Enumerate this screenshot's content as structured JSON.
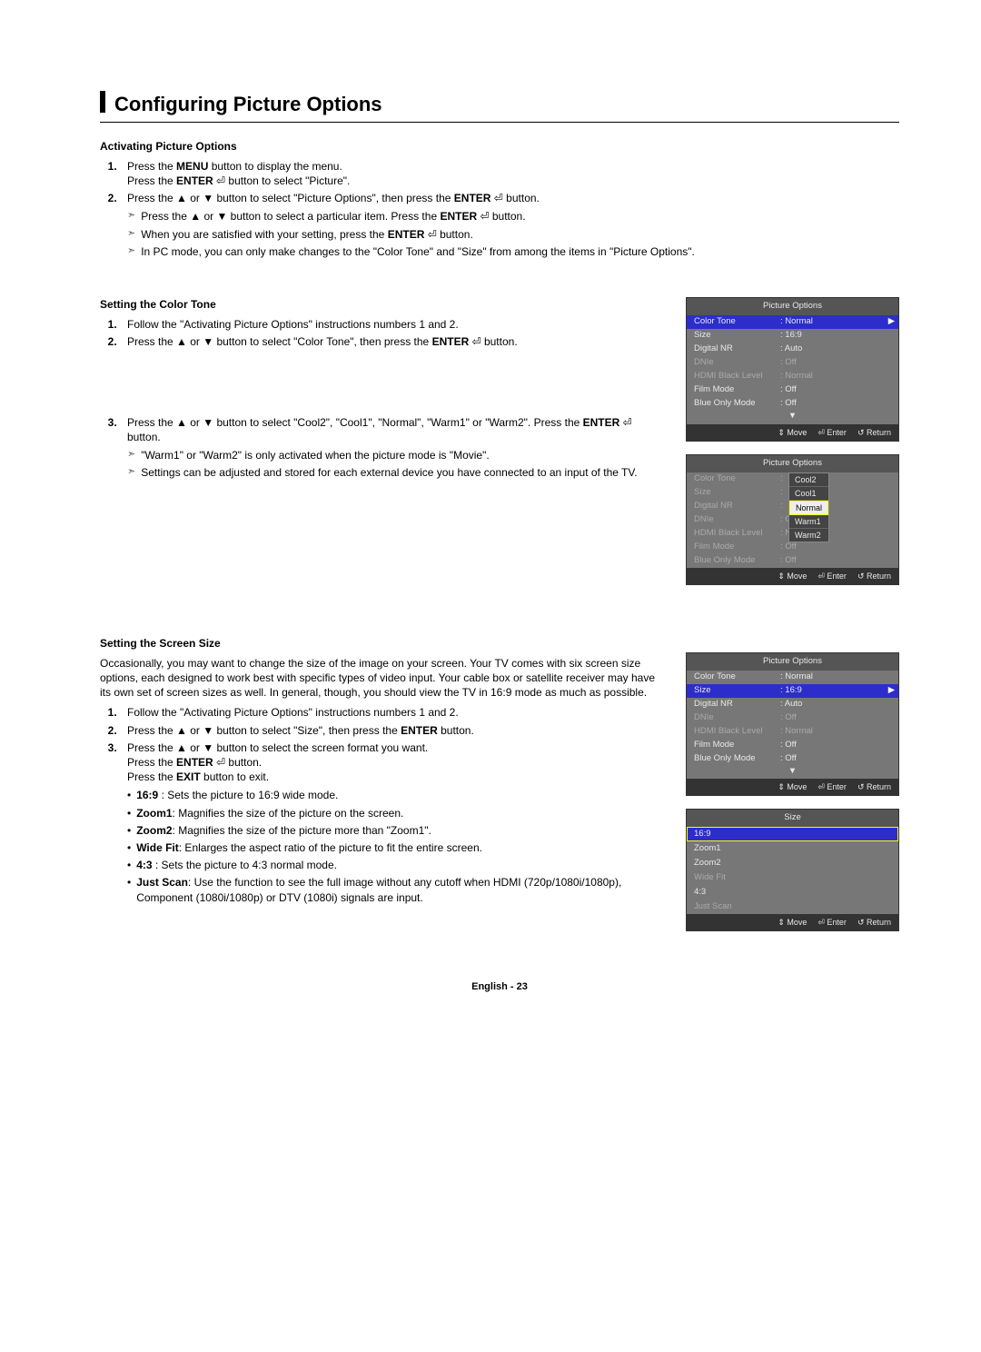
{
  "page": {
    "title": "Configuring Picture Options",
    "footer_lang": "English - ",
    "footer_num": "23"
  },
  "activating": {
    "heading": "Activating Picture Options",
    "step1a": "Press the ",
    "step1b": "MENU",
    "step1c": " button to display the menu.",
    "step1d": "Press the ",
    "step1e": "ENTER",
    "step1f": " ⏎ button to select \"Picture\".",
    "step2a": "Press the ▲ or ▼ button to select \"Picture Options\", then press the ",
    "step2b": "ENTER",
    "step2c": " ⏎ button.",
    "note1a": "Press the ▲ or ▼ button to select a particular item. Press the ",
    "note1b": "ENTER",
    "note1c": " ⏎ button.",
    "note2a": "When you are satisfied with your setting, press the ",
    "note2b": "ENTER",
    "note2c": " ⏎ button.",
    "note3": "In PC mode, you can only make changes to the \"Color Tone\" and \"Size\" from among the items in \"Picture Options\"."
  },
  "colortone": {
    "heading": "Setting the Color Tone",
    "step1": "Follow the \"Activating Picture Options\" instructions numbers 1 and 2.",
    "step2a": "Press the ▲ or ▼ button to select \"Color Tone\", then press the ",
    "step2b": "ENTER",
    "step2c": " ⏎ button.",
    "step3a": "Press the ▲ or ▼ button to select \"Cool2\", \"Cool1\", \"Normal\", \"Warm1\" or \"Warm2\". Press the ",
    "step3b": "ENTER",
    "step3c": " ⏎ button.",
    "note1": "\"Warm1\" or \"Warm2\" is only activated when the picture mode is \"Movie\".",
    "note2": "Settings can be adjusted and stored for each external device you have connected to an input of the TV."
  },
  "screensize": {
    "heading": "Setting the Screen Size",
    "intro": "Occasionally, you may want to change the size of the image on your screen. Your TV comes with six screen size options, each designed to work best with specific types of video input. Your cable box or satellite receiver may have its own set of screen sizes as well. In general, though, you should view the TV in 16:9 mode as much as possible.",
    "step1": "Follow the \"Activating Picture Options\" instructions numbers 1 and 2.",
    "step2a": "Press the ▲ or ▼ button to select \"Size\", then press the ",
    "step2b": "ENTER",
    "step2c": " button.",
    "step3a": "Press the ▲ or ▼ button to select the screen format you want.",
    "step3b": "Press the ",
    "step3c": "ENTER",
    "step3d": " ⏎ button.",
    "step3e": "Press the ",
    "step3f": "EXIT",
    "step3g": " button to exit.",
    "b1a": "16:9",
    "b1b": " : Sets the picture to 16:9 wide mode.",
    "b2a": "Zoom1",
    "b2b": ": Magnifies the size of the picture on the screen.",
    "b3a": "Zoom2",
    "b3b": ": Magnifies the size of the picture more than \"Zoom1\".",
    "b4a": "Wide Fit",
    "b4b": ": Enlarges the aspect ratio of the picture to fit the entire screen.",
    "b5a": "4:3",
    "b5b": " : Sets the picture to 4:3 normal mode.",
    "b6a": "Just Scan",
    "b6b": ": Use the function to see the full image without any cutoff when HDMI (720p/1080i/1080p), Component (1080i/1080p) or DTV (1080i) signals are input."
  },
  "osd": {
    "title": "Picture Options",
    "footer_move": "⇕ Move",
    "footer_enter": "⏎ Enter",
    "footer_return": "↺ Return",
    "rows": [
      {
        "label": "Color Tone",
        "val": "Normal"
      },
      {
        "label": "Size",
        "val": "16:9"
      },
      {
        "label": "Digital NR",
        "val": "Auto"
      },
      {
        "label": "DNIe",
        "val": "Off",
        "dim": true
      },
      {
        "label": "HDMI Black Level",
        "val": "Normal",
        "dim": true
      },
      {
        "label": "Film Mode",
        "val": "Off"
      },
      {
        "label": "Blue Only Mode",
        "val": "Off"
      }
    ],
    "dropdown": [
      "Cool2",
      "Cool1",
      "Normal",
      "Warm1",
      "Warm2"
    ],
    "size_title": "Size",
    "size_opts": [
      "16:9",
      "Zoom1",
      "Zoom2",
      "Wide Fit",
      "4:3",
      "Just Scan"
    ]
  }
}
